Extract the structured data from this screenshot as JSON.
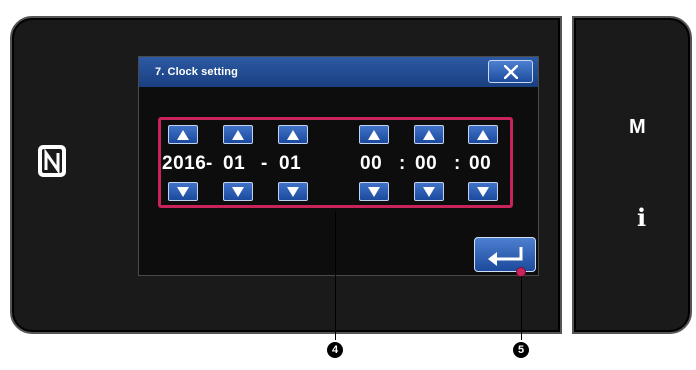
{
  "dialog": {
    "title": "7. Clock setting",
    "close_icon": "close-icon"
  },
  "date_time": {
    "year": "2016",
    "month": "01",
    "day": "01",
    "hour": "00",
    "minute": "00",
    "second": "00",
    "date_separator": "-",
    "time_separator": ":"
  },
  "controls": {
    "up_icon": "triangle-up-icon",
    "down_icon": "triangle-down-icon",
    "enter_icon": "enter-arrow-icon"
  },
  "side_panel": {
    "mode_label": "M",
    "info_label": "i"
  },
  "nfc_icon": "nfc-icon",
  "callouts": {
    "datetime_group": "4",
    "enter_button": "5"
  },
  "colors": {
    "highlight": "#c8235a",
    "button_blue": "#1b4a9e",
    "titlebar": "#1a3f80"
  }
}
